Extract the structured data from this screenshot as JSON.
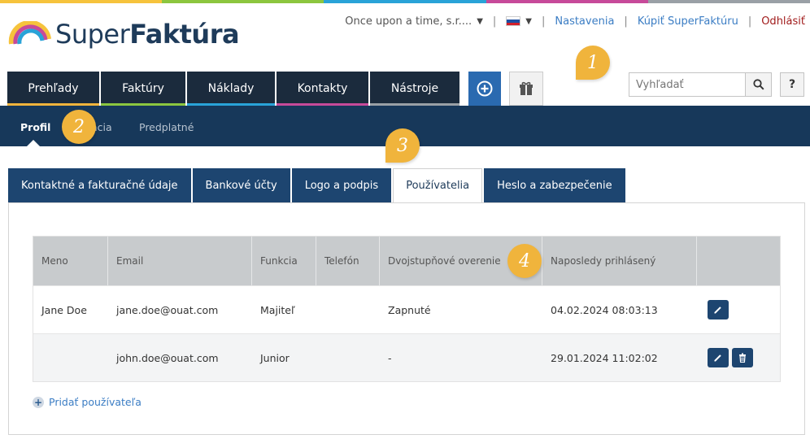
{
  "brand": {
    "logo_text_regular": "Super",
    "logo_text_bold": "Faktúra",
    "strip_colors": [
      "#f6c33c",
      "#8cc63f",
      "#29a3d8",
      "#c74a9a",
      "#9aa0a6"
    ]
  },
  "utility": {
    "company": "Once upon a time, s.r....",
    "settings_link": "Nastavenia",
    "buy_link": "Kúpiť SuperFaktúru",
    "logout_link": "Odhlásiť",
    "separator": "|"
  },
  "main_nav": {
    "tabs": [
      {
        "label": "Prehľady",
        "color": "#f0b43c"
      },
      {
        "label": "Faktúry",
        "color": "#8cc63f"
      },
      {
        "label": "Náklady",
        "color": "#29a3d8"
      },
      {
        "label": "Kontakty",
        "color": "#c74a9a"
      },
      {
        "label": "Nástroje",
        "color": "#9aa0a6"
      }
    ],
    "plus_icon": "plus-circle-icon",
    "gift_icon": "gift-icon"
  },
  "search": {
    "placeholder": "Vyhľadať",
    "icon": "search-icon"
  },
  "help_label": "?",
  "sub_nav": {
    "items": [
      {
        "label": "Profil",
        "active": true
      },
      {
        "label": "ácia",
        "active": false
      },
      {
        "label": "Predplatné",
        "active": false
      }
    ]
  },
  "callouts": [
    "1",
    "2",
    "3",
    "4"
  ],
  "settings_tabs": [
    {
      "label": "Kontaktné a fakturačné údaje",
      "active": false
    },
    {
      "label": "Bankové účty",
      "active": false
    },
    {
      "label": "Logo a podpis",
      "active": false
    },
    {
      "label": "Používatelia",
      "active": true
    },
    {
      "label": "Heslo a zabezpečenie",
      "active": false
    }
  ],
  "users_table": {
    "columns": [
      "Meno",
      "Email",
      "Funkcia",
      "Telefón",
      "Dvojstupňové overenie",
      "Naposledy prihlásený",
      ""
    ],
    "rows": [
      {
        "name": "Jane Doe",
        "email": "jane.doe@ouat.com",
        "role": "Majiteľ",
        "phone": "",
        "two_factor": "Zapnuté",
        "last_login": "04.02.2024 08:03:13",
        "actions": [
          "edit-icon"
        ]
      },
      {
        "name": "",
        "email": "john.doe@ouat.com",
        "role": "Junior",
        "phone": "",
        "two_factor": "-",
        "last_login": "29.01.2024 11:02:02",
        "actions": [
          "edit-icon",
          "trash-icon"
        ]
      }
    ]
  },
  "add_user_label": "Pridať používateľa"
}
